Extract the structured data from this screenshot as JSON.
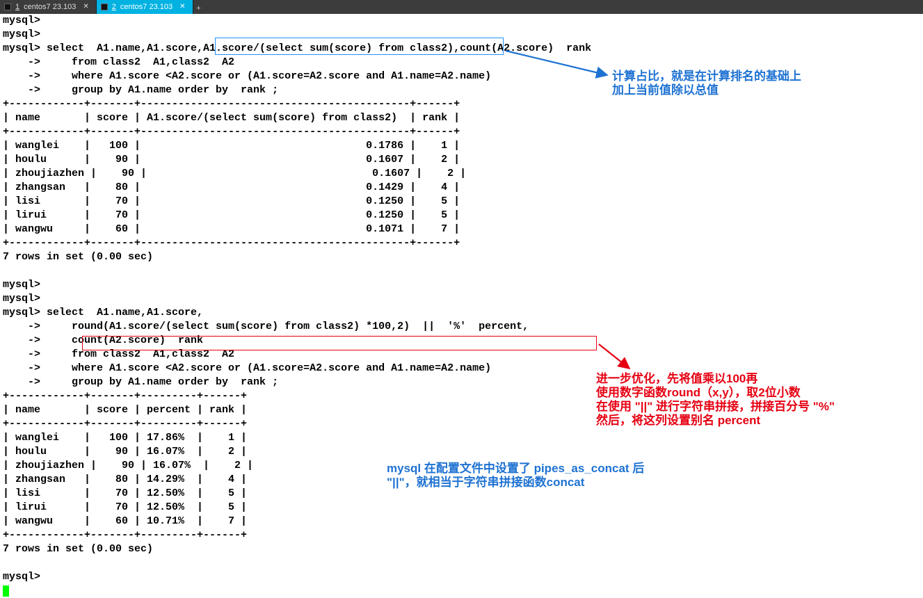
{
  "tabs": [
    {
      "num": "1",
      "label": "centos7  23.103"
    },
    {
      "num": "2",
      "label": "centos7  23.103"
    }
  ],
  "terminal": {
    "p1": "mysql>",
    "p2": "mysql>",
    "p3": "mysql> select  A1.name,A1.score,A1.score/(select sum(score) from class2),count(A2.score)  rank",
    "p4": "    ->     from class2  A1,class2  A2",
    "p5": "    ->     where A1.score <A2.score or (A1.score=A2.score and A1.name=A2.name)",
    "p6": "    ->     group by A1.name order by  rank ;",
    "t1sep": "+------------+-------+-------------------------------------------+------+",
    "t1hdr": "| name       | score | A1.score/(select sum(score) from class2)  | rank |",
    "t1r1": "| wanglei    |   100 |                                    0.1786 |    1 |",
    "t1r2": "| houlu      |    90 |                                    0.1607 |    2 |",
    "t1r3": "| zhoujiazhen |    90 |                                    0.1607 |    2 |",
    "t1r4": "| zhangsan   |    80 |                                    0.1429 |    4 |",
    "t1r5": "| lisi       |    70 |                                    0.1250 |    5 |",
    "t1r6": "| lirui      |    70 |                                    0.1250 |    5 |",
    "t1r7": "| wangwu     |    60 |                                    0.1071 |    7 |",
    "res1": "7 rows in set (0.00 sec)",
    "blank": " ",
    "q2a": "mysql>",
    "q2b": "mysql>",
    "q2c": "mysql> select  A1.name,A1.score,",
    "q2d": "    ->     round(A1.score/(select sum(score) from class2) *100,2)  ||  '%'  percent,",
    "q2e": "    ->     count(A2.score)  rank",
    "q2f": "    ->     from class2  A1,class2  A2",
    "q2g": "    ->     where A1.score <A2.score or (A1.score=A2.score and A1.name=A2.name)",
    "q2h": "    ->     group by A1.name order by  rank ;",
    "t2sep": "+------------+-------+---------+------+",
    "t2hdr": "| name       | score | percent | rank |",
    "t2r1": "| wanglei    |   100 | 17.86%  |    1 |",
    "t2r2": "| houlu      |    90 | 16.07%  |    2 |",
    "t2r3": "| zhoujiazhen |    90 | 16.07%  |    2 |",
    "t2r4": "| zhangsan   |    80 | 14.29%  |    4 |",
    "t2r5": "| lisi       |    70 | 12.50%  |    5 |",
    "t2r6": "| lirui      |    70 | 12.50%  |    5 |",
    "t2r7": "| wangwu     |    60 | 10.71%  |    7 |",
    "res2": "7 rows in set (0.00 sec)",
    "last": "mysql> "
  },
  "annotations": {
    "a1l1": "计算占比，就是在计算排名的基础上",
    "a1l2": "加上当前值除以总值",
    "a2l1": "进一步优化，先将值乘以100再",
    "a2l2": "使用数字函数round（x,y），取2位小数",
    "a2l3": "在使用 \"||\" 进行字符串拼接，拼接百分号 \"%\"",
    "a2l4": "然后，将这列设置别名 percent",
    "a3l1": "mysql 在配置文件中设置了 pipes_as_concat 后",
    "a3l2": "\"||\"，就相当于字符串拼接函数concat"
  },
  "arrows": {
    "blue": {
      "color": "#1e72d2"
    },
    "red": {
      "color": "#e60012"
    }
  }
}
